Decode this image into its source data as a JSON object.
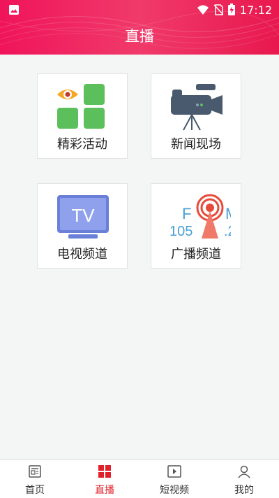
{
  "status_bar": {
    "time": "17:12"
  },
  "header": {
    "title": "直播"
  },
  "cards": [
    {
      "label": "精彩活动",
      "icon": "eye-grid-icon"
    },
    {
      "label": "新闻现场",
      "icon": "video-camera-icon"
    },
    {
      "label": "电视频道",
      "icon": "tv-icon",
      "icon_text": "TV"
    },
    {
      "label": "广播频道",
      "icon": "radio-tower-icon",
      "icon_text_left": "F",
      "icon_text_right": "M",
      "icon_num_left": "105",
      "icon_num_right": ".2"
    }
  ],
  "bottom_nav": [
    {
      "label": "首页",
      "icon": "newspaper-icon",
      "active": false
    },
    {
      "label": "直播",
      "icon": "live-grid-icon",
      "active": true
    },
    {
      "label": "短视频",
      "icon": "play-video-icon",
      "active": false
    },
    {
      "label": "我的",
      "icon": "user-icon",
      "active": false
    }
  ],
  "colors": {
    "accent": "#e0202a",
    "header": "#f0145a"
  }
}
